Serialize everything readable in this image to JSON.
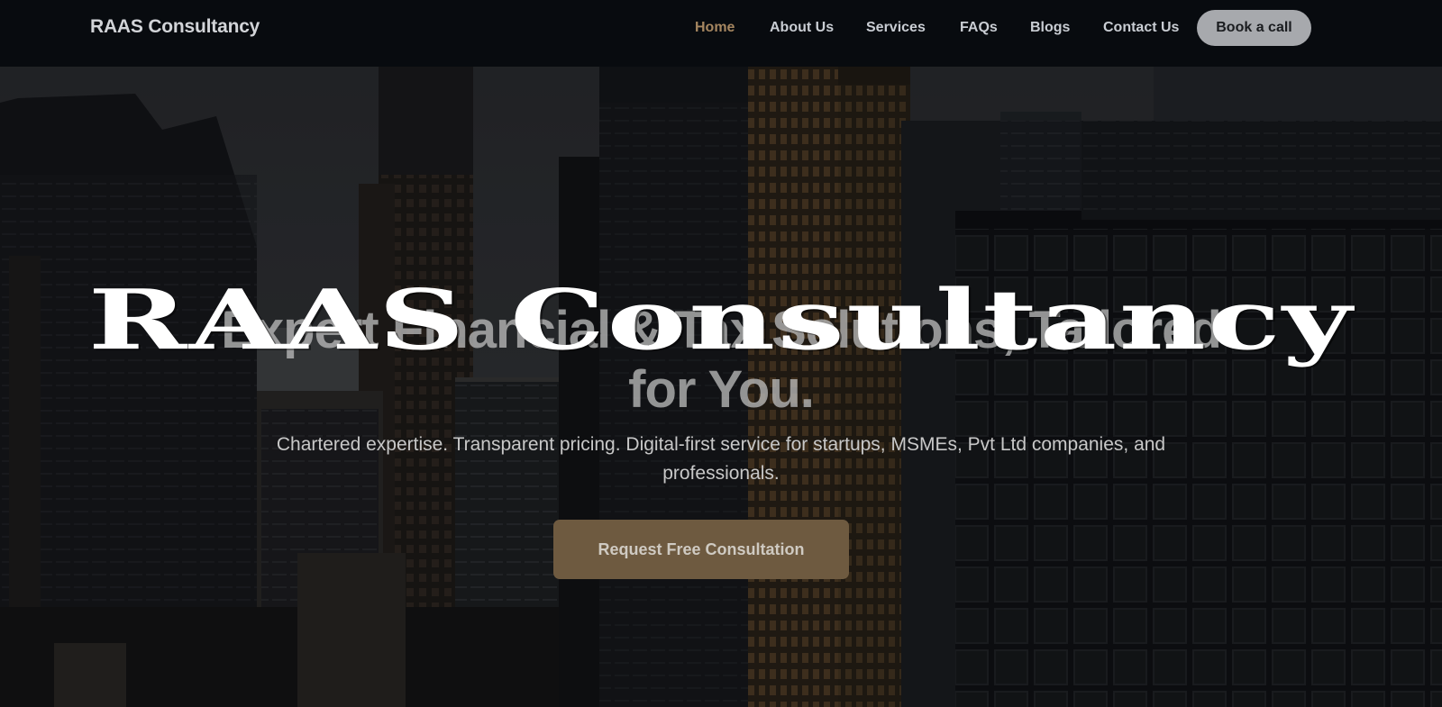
{
  "nav": {
    "brand": "RAAS Consultancy",
    "links": [
      {
        "label": "Home",
        "active": true
      },
      {
        "label": "About Us"
      },
      {
        "label": "Services"
      },
      {
        "label": "FAQs"
      },
      {
        "label": "Blogs"
      },
      {
        "label": "Contact Us"
      }
    ],
    "cta_label": "Book a call"
  },
  "hero": {
    "overlay_title": "RAAS Consultancy",
    "headline_line1": "Expert Financial & Tax Solutions, Tailored",
    "headline_line2": "for You.",
    "subtitle": "Chartered expertise. Transparent pricing. Digital-first service for startups, MSMEs, Pvt Ltd companies, and professionals.",
    "cta_label": "Request Free Consultation"
  },
  "colors": {
    "nav_bg": "#080b0f",
    "active_link": "#a58660",
    "cta_bg": "#6e5a40",
    "book_btn_bg": "#a7a9ad"
  }
}
